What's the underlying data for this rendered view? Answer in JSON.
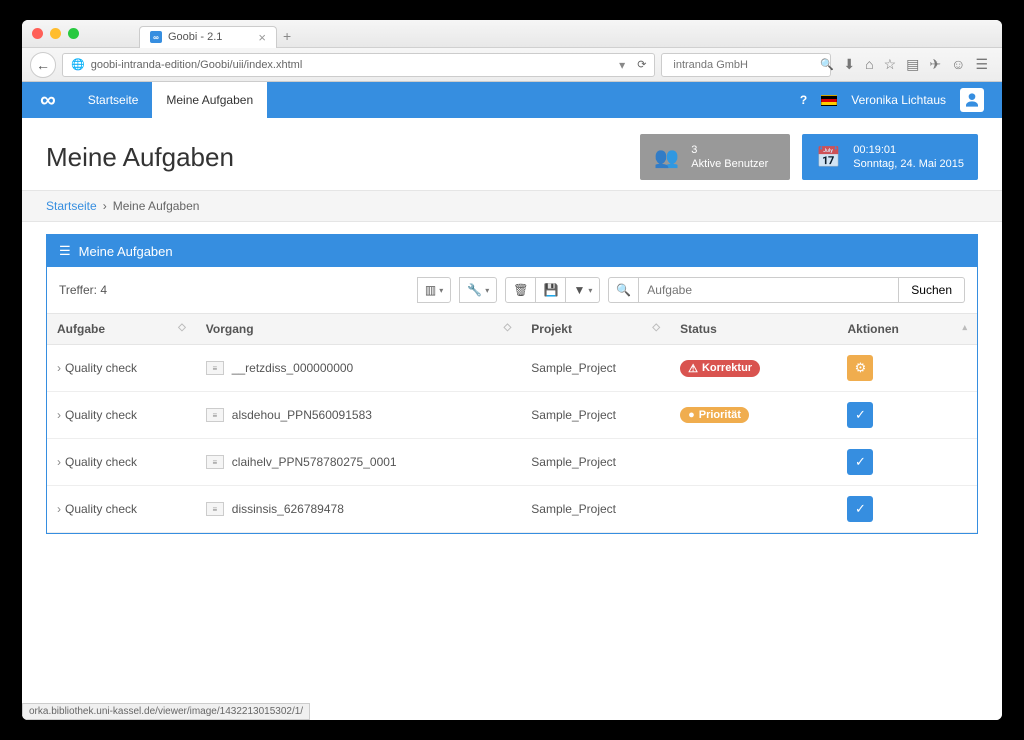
{
  "browser": {
    "tab_title": "Goobi - 2.1",
    "url": "goobi-intranda-edition/Goobi/uii/index.xhtml",
    "search_placeholder": "intranda GmbH",
    "status_url": "orka.bibliothek.uni-kassel.de/viewer/image/1432213015302/1/"
  },
  "nav": {
    "home": "Startseite",
    "tasks": "Meine Aufgaben",
    "help": "?",
    "user": "Veronika Lichtaus"
  },
  "page": {
    "title": "Meine Aufgaben",
    "active_users_count": "3",
    "active_users_label": "Aktive Benutzer",
    "clock_time": "00:19:01",
    "clock_date": "Sonntag, 24. Mai 2015"
  },
  "breadcrumb": {
    "home": "Startseite",
    "sep": "›",
    "current": "Meine Aufgaben"
  },
  "panel": {
    "title": "Meine Aufgaben",
    "hits_label": "Treffer: 4",
    "search_placeholder": "Aufgabe",
    "search_button": "Suchen"
  },
  "table": {
    "headers": {
      "task": "Aufgabe",
      "process": "Vorgang",
      "project": "Projekt",
      "status": "Status",
      "actions": "Aktionen"
    },
    "rows": [
      {
        "task": "Quality check",
        "process": "__retzdiss_000000000",
        "project": "Sample_Project",
        "status_label": "Korrektur",
        "status_color": "red",
        "action": "gear"
      },
      {
        "task": "Quality check",
        "process": "alsdehou_PPN560091583",
        "project": "Sample_Project",
        "status_label": "Priorität",
        "status_color": "orange",
        "action": "check"
      },
      {
        "task": "Quality check",
        "process": "claihelv_PPN578780275_0001",
        "project": "Sample_Project",
        "status_label": "",
        "status_color": "",
        "action": "check"
      },
      {
        "task": "Quality check",
        "process": "dissinsis_626789478",
        "project": "Sample_Project",
        "status_label": "",
        "status_color": "",
        "action": "check"
      }
    ]
  }
}
